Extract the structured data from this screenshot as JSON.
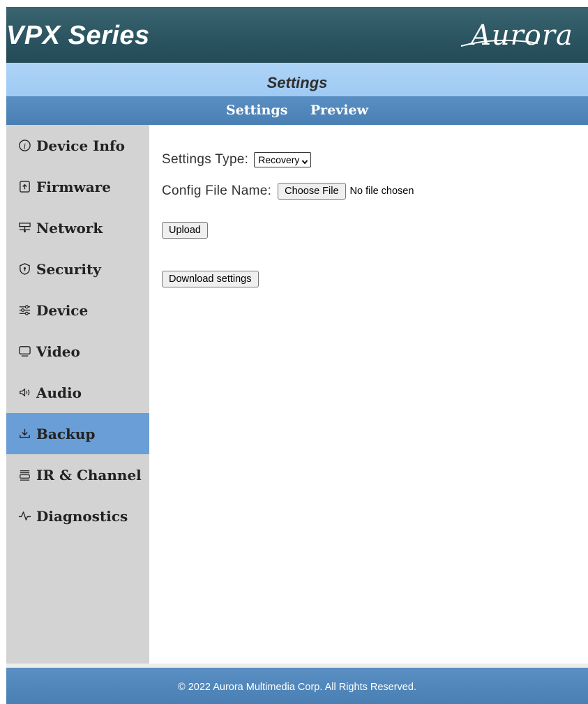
{
  "header": {
    "brand_title": "VPX Series",
    "logo_text": "Aurora"
  },
  "page_title": "Settings",
  "tabs": [
    {
      "label": "Settings"
    },
    {
      "label": "Preview"
    }
  ],
  "sidebar": {
    "items": [
      {
        "label": "Device Info",
        "icon": "info-icon"
      },
      {
        "label": "Firmware",
        "icon": "upload-file-icon"
      },
      {
        "label": "Network",
        "icon": "network-icon"
      },
      {
        "label": "Security",
        "icon": "shield-icon"
      },
      {
        "label": "Device",
        "icon": "sliders-icon"
      },
      {
        "label": "Video",
        "icon": "monitor-icon"
      },
      {
        "label": "Audio",
        "icon": "speaker-icon"
      },
      {
        "label": "Backup",
        "icon": "download-icon",
        "active": true
      },
      {
        "label": "IR & Channel",
        "icon": "ir-icon"
      },
      {
        "label": "Diagnostics",
        "icon": "pulse-icon"
      }
    ]
  },
  "main": {
    "settings_type_label": "Settings Type:",
    "settings_type_value": "Recovery",
    "config_file_label": "Config File Name:",
    "choose_file_label": "Choose File",
    "file_status": "No file chosen",
    "upload_label": "Upload",
    "download_label": "Download settings"
  },
  "footer": {
    "copyright": "© 2022 Aurora Multimedia Corp. All Rights Reserved."
  },
  "colors": {
    "header_bg": "#2b5561",
    "title_band_bg": "#a3cdf4",
    "nav_bg": "#4f84b9",
    "sidebar_bg": "#d3d3d3",
    "sidebar_active_bg": "#6a9ed6"
  }
}
